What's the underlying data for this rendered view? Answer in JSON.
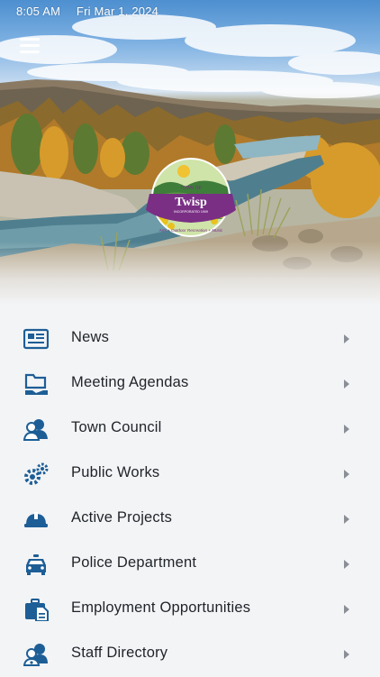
{
  "status_bar": {
    "time": "8:05 AM",
    "date": "Fri Mar 1, 2024"
  },
  "header": {
    "menu_icon": "hamburger-menu-icon"
  },
  "logo": {
    "line1": "TOWN OF",
    "name": "Twisp",
    "line2": "INCORPORATED 1909",
    "tagline": "Arts + Outdoor Recreation + Music"
  },
  "colors": {
    "accent": "#1d5e96",
    "logo_purple": "#7a2f85",
    "background": "#f3f4f6"
  },
  "menu": {
    "items": [
      {
        "label": "News",
        "icon": "newspaper-icon"
      },
      {
        "label": "Meeting Agendas",
        "icon": "folder-hand-icon"
      },
      {
        "label": "Town Council",
        "icon": "people-icon"
      },
      {
        "label": "Public Works",
        "icon": "gears-icon"
      },
      {
        "label": "Active Projects",
        "icon": "hard-hat-icon"
      },
      {
        "label": "Police Department",
        "icon": "police-car-icon"
      },
      {
        "label": "Employment Opportunities",
        "icon": "briefcase-document-icon"
      },
      {
        "label": "Staff Directory",
        "icon": "staff-people-icon"
      }
    ]
  }
}
